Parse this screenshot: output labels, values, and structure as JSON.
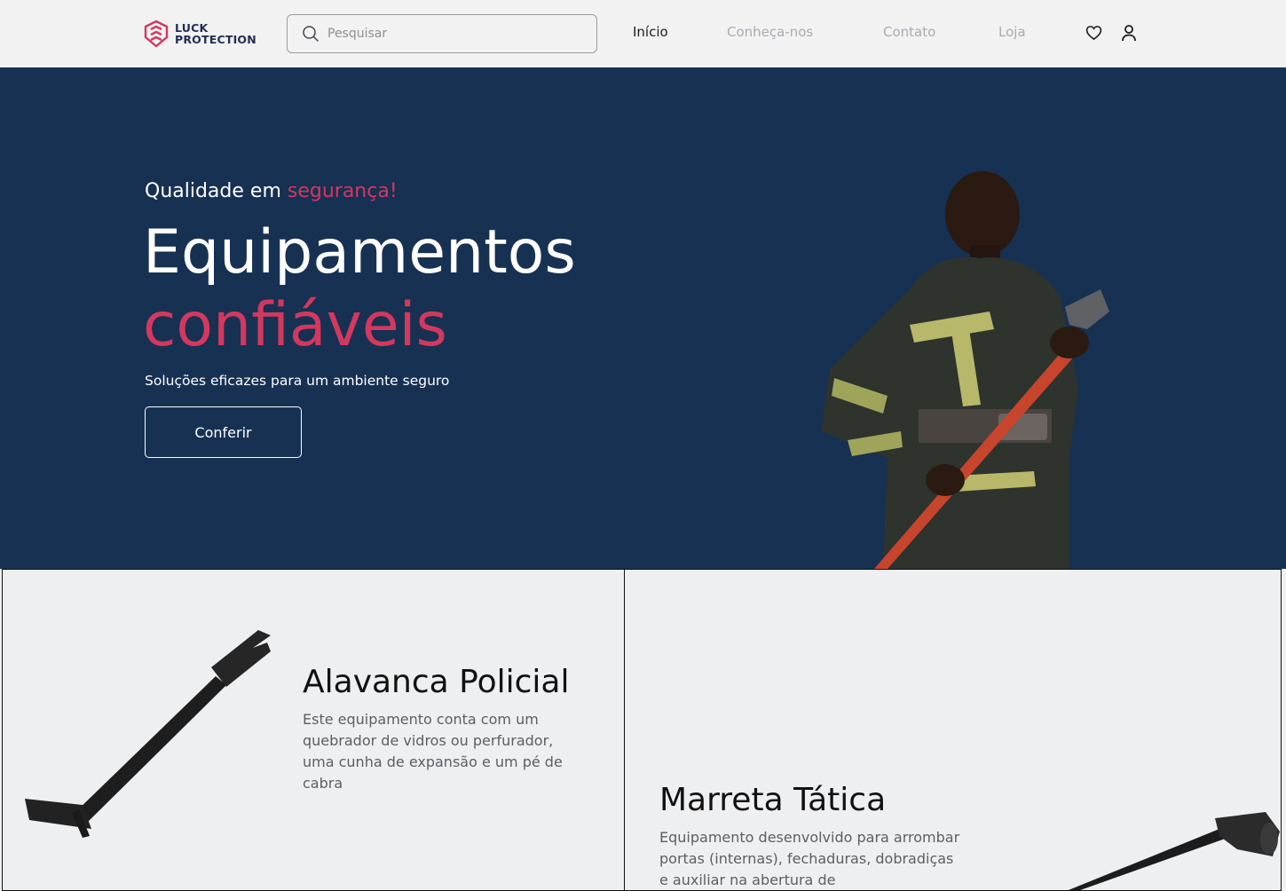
{
  "header": {
    "logo_line1": "LUCK",
    "logo_line2": "PROTECTION",
    "search_placeholder": "Pesquisar",
    "nav": [
      {
        "label": "Início",
        "active": true
      },
      {
        "label": "Conheça-nos",
        "active": false
      },
      {
        "label": "Contato",
        "active": false
      },
      {
        "label": "Loja",
        "active": false
      }
    ],
    "icons": [
      "heart-icon",
      "user-icon"
    ]
  },
  "hero": {
    "tag_prefix": "Qualidade em ",
    "tag_accent": "segurança!",
    "title_line1": "Equipamentos",
    "title_line2": "confiáveis",
    "subtitle": "Soluções eficazes para um ambiente seguro",
    "cta": "Conferir"
  },
  "products": [
    {
      "title": "Alavanca Policial",
      "description": "Este equipamento conta com um quebrador de vidros ou perfurador, uma cunha de expansão e um pé de cabra"
    },
    {
      "title": "Marreta Tática",
      "description": "Equipamento desenvolvido para arrombar portas (internas), fechaduras, dobradiças e auxiliar na abertura de"
    }
  ],
  "colors": {
    "hero_bg": "#173152",
    "accent": "#d3385f",
    "header_bg": "#f2f2f3",
    "card_bg": "#eeeff1"
  }
}
